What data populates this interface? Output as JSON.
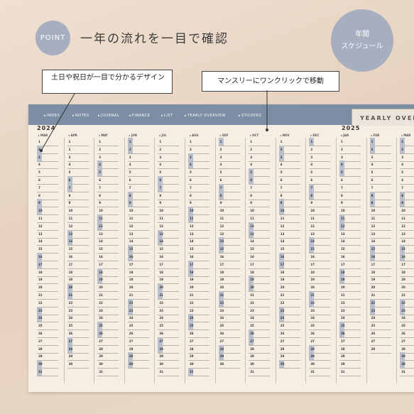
{
  "point_label": "POINT",
  "headline": "一年の流れを一目で確認",
  "badge": {
    "line1": "年間",
    "line2": "スケジュール"
  },
  "callouts": {
    "weekend": "土日や祝日が一目で分かるデザイン",
    "link": "マンスリーにワンクリックで移動"
  },
  "nav": [
    "INDEX",
    "NOTES",
    "JOURNAL",
    "FINANCE",
    "LIST",
    "YEARLY OVERVIEW",
    "STICKERS"
  ],
  "tab_label": "YEARLY OVERVIEW",
  "years": [
    "2024",
    "2025"
  ],
  "months": [
    "MAR",
    "APR",
    "MAY",
    "JUN",
    "JUL",
    "AUG",
    "SEP",
    "OCT",
    "NOV",
    "DEC",
    "JAN",
    "FEB",
    "MAR"
  ],
  "colors": {
    "nav": "#7b8ea3",
    "weekend": "#b9c0cb",
    "badge": "#a6aebf"
  },
  "calendar": {
    "days_in_month": [
      31,
      30,
      31,
      30,
      31,
      31,
      30,
      31,
      30,
      31,
      31,
      28,
      31
    ],
    "start_weekday": [
      5,
      1,
      3,
      6,
      1,
      4,
      0,
      2,
      5,
      0,
      3,
      6,
      6
    ]
  }
}
